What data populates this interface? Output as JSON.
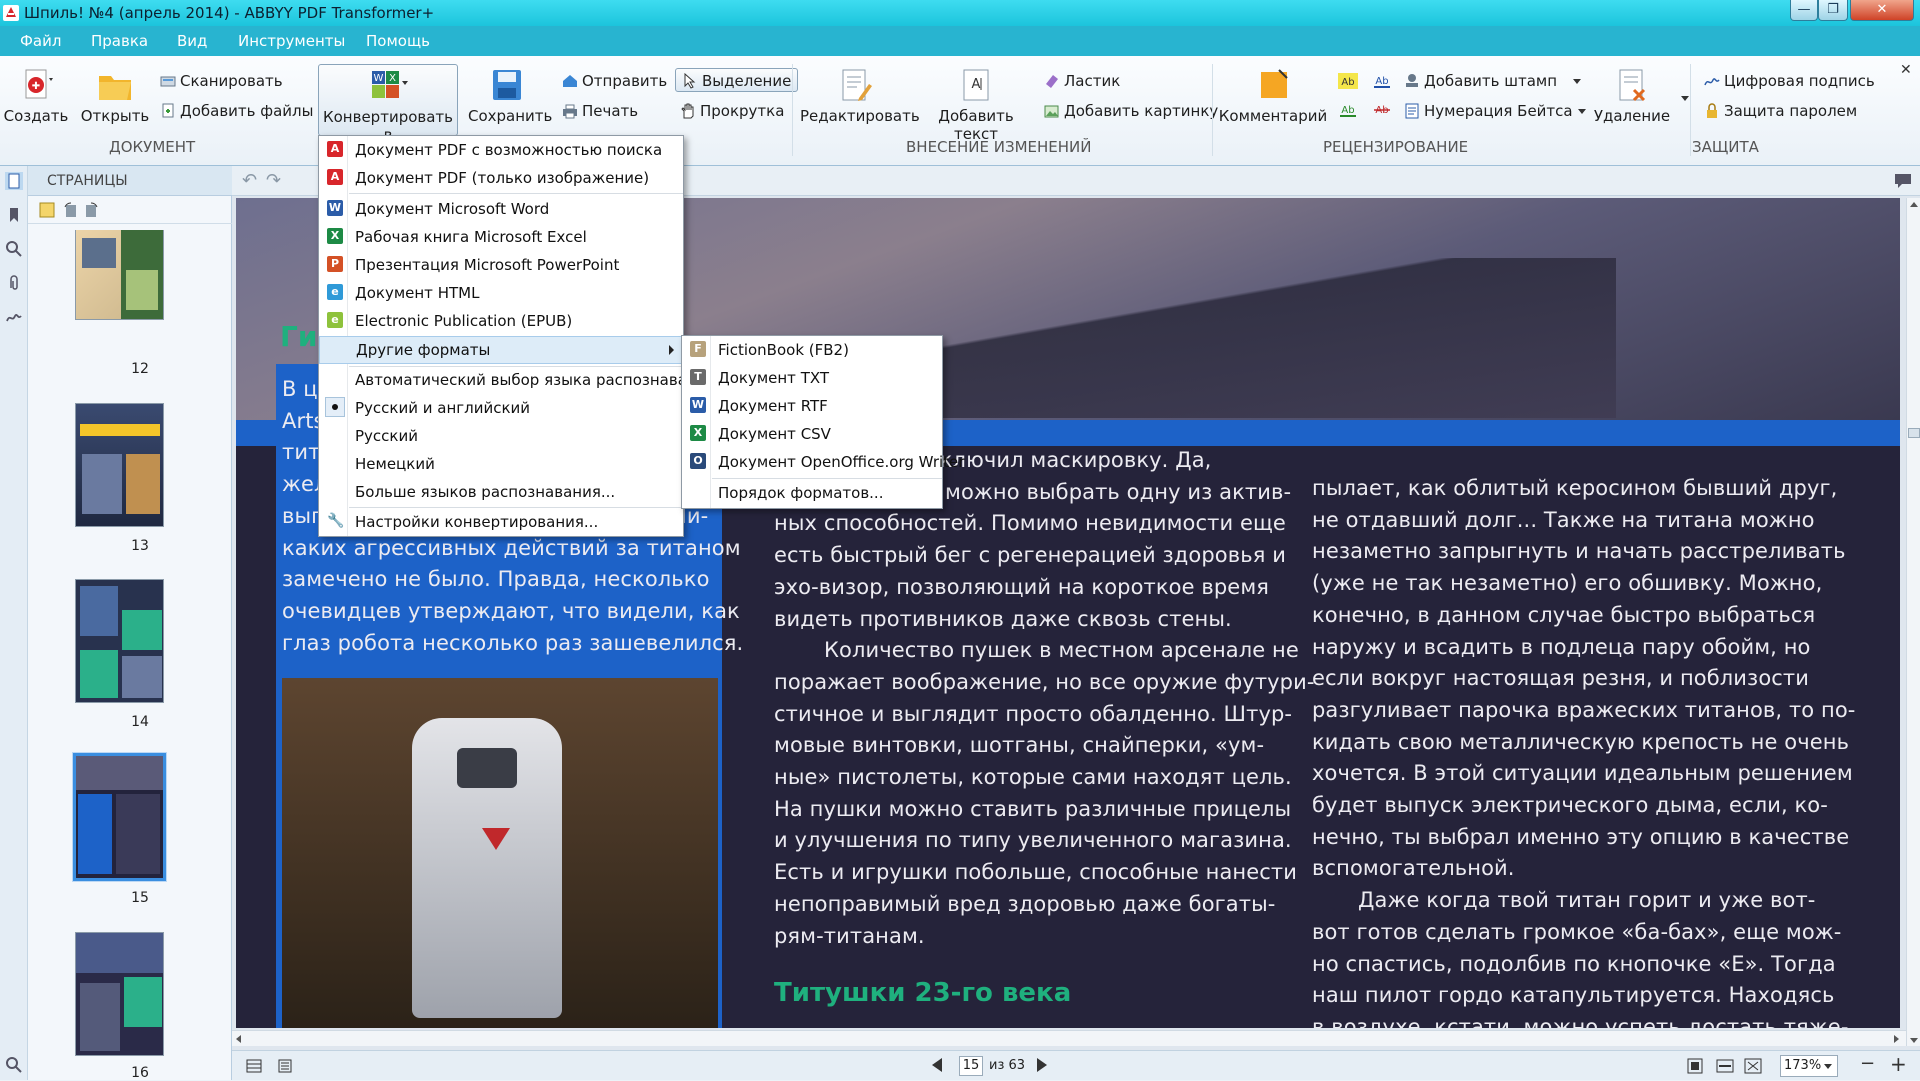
{
  "window": {
    "title": "Шпиль! №4 (апрель 2014) - ABBYY PDF Transformer+",
    "controls": [
      "minimize",
      "maximize",
      "close"
    ]
  },
  "menubar": [
    "Файл",
    "Правка",
    "Вид",
    "Инструменты",
    "Помощь"
  ],
  "ribbon": {
    "document": {
      "group_label": "ДОКУМЕНТ",
      "create": "Создать",
      "open": "Открыть",
      "scan": "Сканировать",
      "add_files": "Добавить файлы",
      "convert": "Конвертировать в",
      "save": "Сохранить",
      "send": "Отправить",
      "print": "Печать",
      "select": "Выделение",
      "scroll": "Прокрутка"
    },
    "edit": {
      "group_label": "ВНЕСЕНИЕ ИЗМЕНЕНИЙ",
      "edit": "Редактировать",
      "add_text": "Добавить текст",
      "eraser": "Ластик",
      "add_picture": "Добавить картинку"
    },
    "review": {
      "group_label": "РЕЦЕНЗИРОВАНИЕ",
      "comment": "Комментарий",
      "add_stamp": "Добавить штамп",
      "bates": "Нумерация Бейтса",
      "delete": "Удаление"
    },
    "protect": {
      "group_label": "ЗАЩИТА",
      "signature": "Цифровая подпись",
      "password": "Защита паролем"
    }
  },
  "pages_panel": {
    "title": "СТРАНИЦЫ",
    "thumbnails": [
      {
        "number": "12",
        "selected": false
      },
      {
        "number": "13",
        "selected": false
      },
      {
        "number": "14",
        "selected": false
      },
      {
        "number": "15",
        "selected": true
      },
      {
        "number": "16",
        "selected": false
      }
    ]
  },
  "convert_menu": {
    "items": [
      {
        "label": "Документ PDF с возможностью поиска",
        "icon": "pdf-searchable-icon"
      },
      {
        "label": "Документ PDF (только изображение)",
        "icon": "pdf-image-icon"
      },
      {
        "label": "Документ Microsoft Word",
        "icon": "word-icon"
      },
      {
        "label": "Рабочая книга Microsoft Excel",
        "icon": "excel-icon"
      },
      {
        "label": "Презентация Microsoft PowerPoint",
        "icon": "powerpoint-icon"
      },
      {
        "label": "Документ HTML",
        "icon": "html-icon"
      },
      {
        "label": "Electronic Publication (EPUB)",
        "icon": "epub-icon"
      },
      {
        "label": "Другие форматы",
        "icon": "",
        "has_submenu": true,
        "highlighted": true
      },
      {
        "label": "Автоматический выбор языка распознавания",
        "icon": ""
      },
      {
        "label": "Русский и английский",
        "icon": "radio-dot-icon",
        "checked": true
      },
      {
        "label": "Русский",
        "icon": ""
      },
      {
        "label": "Немецкий",
        "icon": ""
      },
      {
        "label": "Больше языков распознавания...",
        "icon": ""
      },
      {
        "label": "Настройки конвертирования...",
        "icon": "wrench-icon"
      }
    ]
  },
  "other_formats_submenu": {
    "items": [
      {
        "label": "FictionBook (FB2)",
        "icon": "fb2-icon"
      },
      {
        "label": "Документ TXT",
        "icon": "txt-icon"
      },
      {
        "label": "Документ RTF",
        "icon": "rtf-icon"
      },
      {
        "label": "Документ CSV",
        "icon": "csv-icon"
      },
      {
        "label": "Документ OpenOffice.org Writer",
        "icon": "odt-icon"
      },
      {
        "label": "Порядок форматов...",
        "icon": ""
      }
    ]
  },
  "page_content": {
    "headline_fragment": "Ги",
    "blue_box_lines": [
      "В ц",
      "Arts",
      "тита",
      "жел",
      "выг",
      "каких агрессивных действий за титаном",
      "замечено не было. Правда, несколько",
      "очевидцев утверждают, что видели, как",
      "глаз робота несколько раз зашевелился."
    ],
    "blue_box_right_fragment": "Ни-",
    "col2_lines": [
      "ется, включил маскировку. Да,",
      "своему пилоту можно выбрать одну из актив-",
      "ных способностей. Помимо невидимости еще",
      "есть быстрый бег с регенерацией здоровья и",
      "эхо-визор, позволяющий на короткое время",
      "видеть противников даже сквозь стены.",
      "Количество пушек в местном арсенале не",
      "поражает воображение, но все оружие футури-",
      "стичное и выглядит просто обалденно. Штур-",
      "мовые винтовки, шотганы, снайперки, «ум-",
      "ные» пистолеты, которые сами находят цель.",
      "На пушки можно ставить различные прицелы",
      "и улучшения по типу увеличенного магазина.",
      "Есть и игрушки побольше, способные нанести",
      "непоправимый вред здоровью даже богаты-",
      "рям-титанам."
    ],
    "col2_heading": "Титушки 23-го века",
    "col3_lines": [
      "пылает, как облитый керосином бывший друг,",
      "не отдавший долг... Также на титана можно",
      "незаметно запрыгнуть и начать расстреливать",
      "(уже не так незаметно) его обшивку. Можно,",
      "конечно, в данном случае быстро выбраться",
      "наружу и всадить в подлеца пару обойм, но",
      "если вокруг настоящая резня, и поблизости",
      "разгуливает парочка вражеских титанов, то по-",
      "кидать свою металлическую крепость не очень",
      "хочется. В этой ситуации идеальным решением",
      "будет выпуск электрического дыма, если, ко-",
      "нечно, ты выбрал именно эту опцию в качестве",
      "вспомогательной.",
      "Даже когда твой титан горит и уже вот-",
      "вот готов сделать громкое «ба-бах», еще мож-",
      "но спастись, подолбив по кнопочке «E». Тогда",
      "наш пилот гордо катапультируется. Находясь",
      "в воздухе, кстати, можно успеть достать тяже-"
    ]
  },
  "statusbar": {
    "current_page": "15",
    "of_pages": "из 63",
    "zoom": "173%",
    "zoom_out": "−",
    "zoom_in": "+"
  },
  "colors": {
    "titlebar": "#2bd0e6",
    "menubar": "#28b4d0",
    "page_dark": "#25233a",
    "accent_green": "#1fb07e",
    "accent_blue": "#1d62c8",
    "menu_highlight": "#ddecf8"
  }
}
